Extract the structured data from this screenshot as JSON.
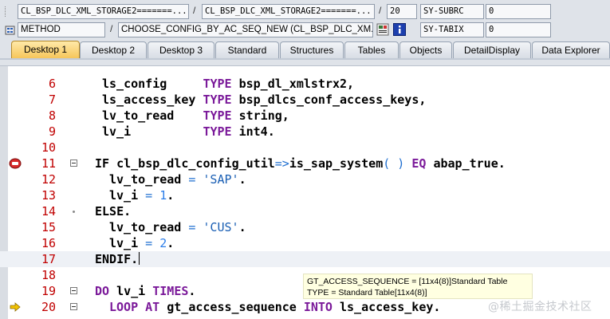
{
  "header": {
    "row1": {
      "program": "CL_BSP_DLC_XML_STORAGE2=======...",
      "include": "CL_BSP_DLC_XML_STORAGE2=======...",
      "line": "20",
      "sysvar_name": "SY-SUBRC",
      "sysvar_value": "0"
    },
    "row2": {
      "event_type": "METHOD",
      "event_name": "CHOOSE_CONFIG_BY_AC_SEQ_NEW (CL_BSP_DLC_XM...",
      "sysvar_name": "SY-TABIX",
      "sysvar_value": "0"
    },
    "separator": "/"
  },
  "tabs": [
    {
      "label": "Desktop 1",
      "active": true
    },
    {
      "label": "Desktop 2"
    },
    {
      "label": "Desktop 3"
    },
    {
      "label": "Standard"
    },
    {
      "label": "Structures"
    },
    {
      "label": "Tables"
    },
    {
      "label": "Objects"
    },
    {
      "label": "DetailDisplay"
    },
    {
      "label": "Data Explorer"
    }
  ],
  "code_lines": [
    {
      "num": "6",
      "indent": "  ",
      "parts": [
        [
          "t",
          "ls_config     "
        ],
        [
          "kw",
          "TYPE"
        ],
        [
          "t",
          " bsp_dl_xmlstrx2,"
        ]
      ]
    },
    {
      "num": "7",
      "indent": "  ",
      "parts": [
        [
          "t",
          "ls_access_key "
        ],
        [
          "kw",
          "TYPE"
        ],
        [
          "t",
          " bsp_dlcs_conf_access_keys,"
        ]
      ]
    },
    {
      "num": "8",
      "indent": "  ",
      "parts": [
        [
          "t",
          "lv_to_read    "
        ],
        [
          "kw",
          "TYPE"
        ],
        [
          "t",
          " string,"
        ]
      ]
    },
    {
      "num": "9",
      "indent": "  ",
      "parts": [
        [
          "t",
          "lv_i          "
        ],
        [
          "kw",
          "TYPE"
        ],
        [
          "t",
          " int4."
        ]
      ]
    },
    {
      "num": "10",
      "indent": "",
      "parts": []
    },
    {
      "num": "11",
      "indent": " ",
      "fold": true,
      "breakpoint": true,
      "parts": [
        [
          "t",
          "IF cl_bsp_dlc_config_util"
        ],
        [
          "op",
          "=>"
        ],
        [
          "t",
          "is_sap_system"
        ],
        [
          "op",
          "( )"
        ],
        [
          "t",
          " "
        ],
        [
          "kw",
          "EQ"
        ],
        [
          "t",
          " abap_true."
        ]
      ]
    },
    {
      "num": "12",
      "indent": "   ",
      "parts": [
        [
          "t",
          "lv_to_read "
        ],
        [
          "op",
          "="
        ],
        [
          "t",
          " "
        ],
        [
          "str",
          "'SAP'"
        ],
        [
          "t",
          "."
        ]
      ]
    },
    {
      "num": "13",
      "indent": "   ",
      "parts": [
        [
          "t",
          "lv_i "
        ],
        [
          "op",
          "="
        ],
        [
          "t",
          " "
        ],
        [
          "num",
          "1"
        ],
        [
          "t",
          "."
        ]
      ]
    },
    {
      "num": "14",
      "indent": " ",
      "dot": true,
      "parts": [
        [
          "t",
          "ELSE."
        ]
      ]
    },
    {
      "num": "15",
      "indent": "   ",
      "parts": [
        [
          "t",
          "lv_to_read "
        ],
        [
          "op",
          "="
        ],
        [
          "t",
          " "
        ],
        [
          "str",
          "'CUS'"
        ],
        [
          "t",
          "."
        ]
      ]
    },
    {
      "num": "16",
      "indent": "   ",
      "parts": [
        [
          "t",
          "lv_i "
        ],
        [
          "op",
          "="
        ],
        [
          "t",
          " "
        ],
        [
          "num",
          "2"
        ],
        [
          "t",
          "."
        ]
      ]
    },
    {
      "num": "17",
      "indent": " ",
      "highlight": true,
      "cursor": true,
      "parts": [
        [
          "t",
          "ENDIF."
        ]
      ]
    },
    {
      "num": "18",
      "indent": "",
      "parts": []
    },
    {
      "num": "19",
      "indent": " ",
      "fold": true,
      "parts": [
        [
          "kw",
          "DO"
        ],
        [
          "t",
          " lv_i "
        ],
        [
          "kw",
          "TIMES"
        ],
        [
          "t",
          "."
        ]
      ]
    },
    {
      "num": "20",
      "indent": "   ",
      "fold": true,
      "current": true,
      "parts": [
        [
          "kw",
          "LOOP AT"
        ],
        [
          "t",
          " gt_access_sequence "
        ],
        [
          "kw",
          "INTO"
        ],
        [
          "t",
          " ls_access_key."
        ]
      ]
    }
  ],
  "tooltip": {
    "line1": "GT_ACCESS_SEQUENCE = [11x4(8)]Standard Table",
    "line2": "TYPE  = Standard Table[11x4(8)]"
  },
  "watermark": "@稀土掘金技术社区",
  "colors": {
    "line_number": "#c00000",
    "keyword": "#7b1a9a",
    "string_literal": "#1a5fb4",
    "active_tab": "#f6c65a"
  }
}
